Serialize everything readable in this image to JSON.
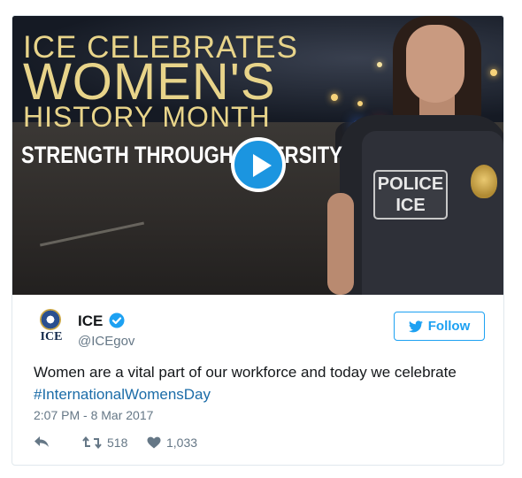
{
  "media": {
    "headline_line1": "ICE CELEBRATES",
    "headline_line2": "WOMEN'S",
    "headline_line3": "HISTORY MONTH",
    "headline_line4": "STRENGTH THROUGH DIVERSITY",
    "patch_line1": "POLICE",
    "patch_line2": "ICE"
  },
  "author": {
    "avatar_text": "ICE",
    "name": "ICE",
    "handle": "@ICEgov",
    "follow_label": "Follow"
  },
  "tweet": {
    "text": "Women are a vital part of our workforce and today we celebrate",
    "hashtag": "#InternationalWomensDay",
    "timestamp": "2:07 PM - 8 Mar 2017"
  },
  "actions": {
    "retweet_count": "518",
    "like_count": "1,033"
  },
  "colors": {
    "accent": "#1da1f2",
    "play_button": "#1b95e0",
    "headline_gold": "#e8d48a"
  }
}
